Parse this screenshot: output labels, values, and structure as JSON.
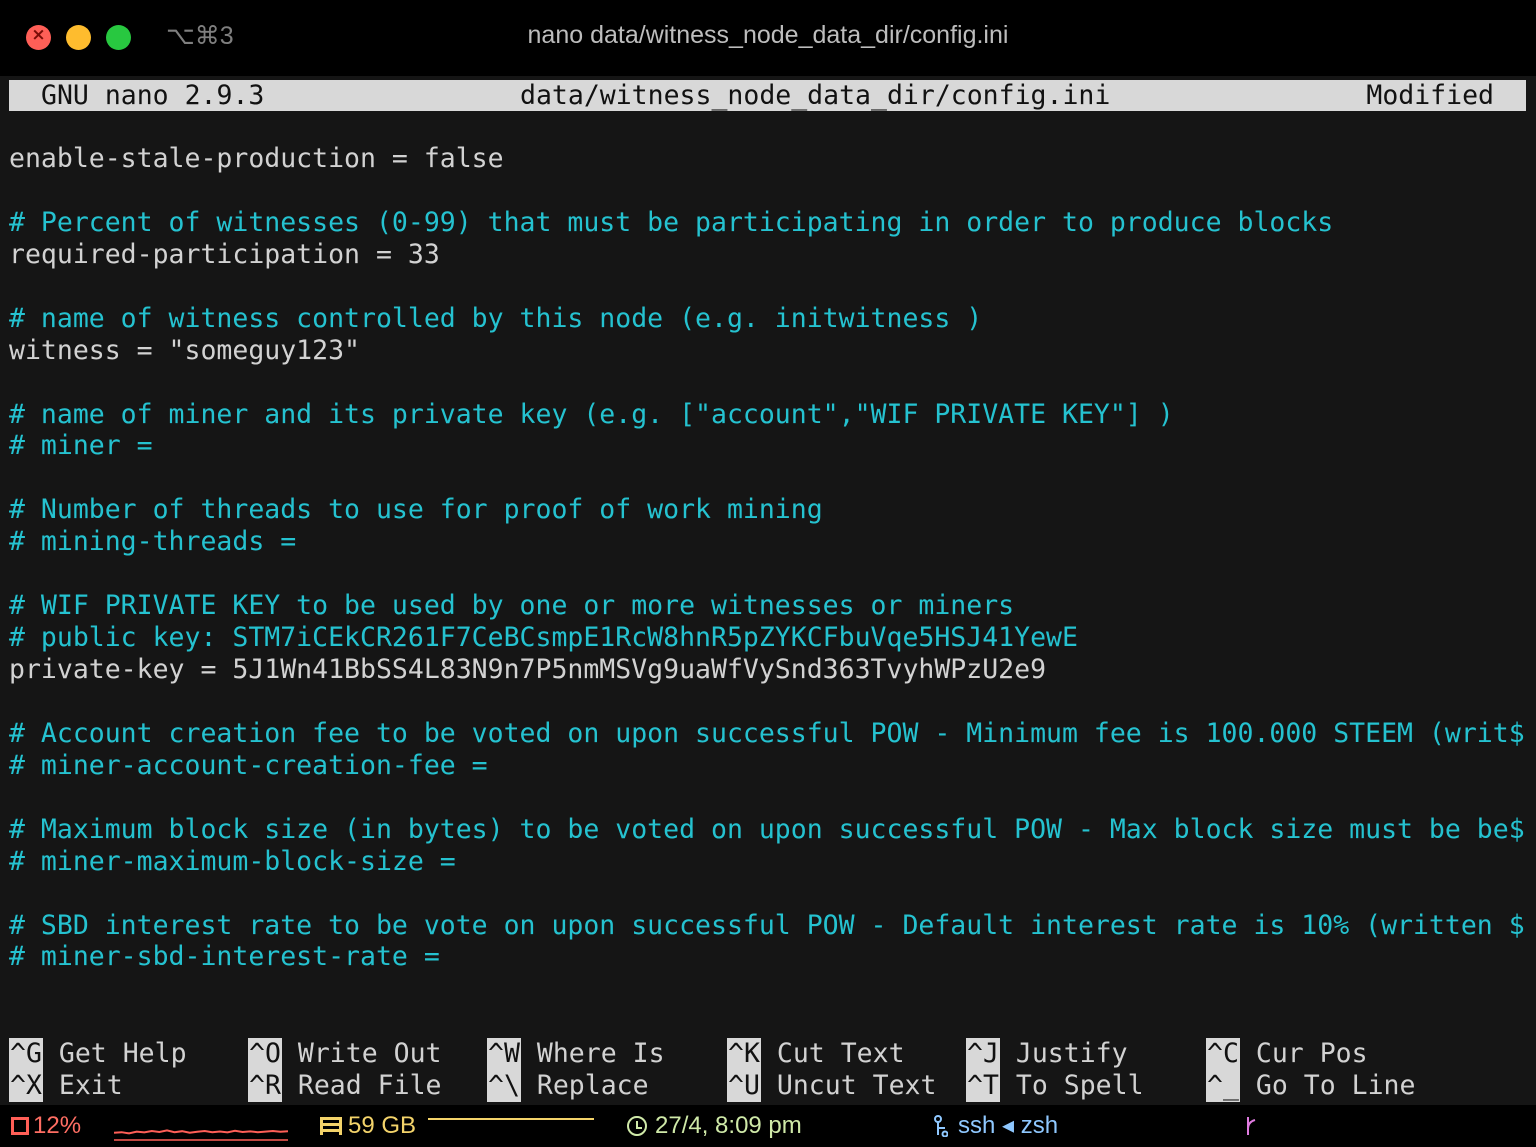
{
  "titlebar": {
    "shortcut": "⌥⌘3",
    "title": "nano data/witness_node_data_dir/config.ini"
  },
  "nano_header": {
    "version": "GNU nano 2.9.3",
    "filename": "data/witness_node_data_dir/config.ini",
    "state": "Modified"
  },
  "buffer": {
    "lines": [
      {
        "kind": "setting",
        "text": "enable-stale-production = false"
      },
      {
        "kind": "blank",
        "text": ""
      },
      {
        "kind": "comment",
        "text": "# Percent of witnesses (0-99) that must be participating in order to produce blocks"
      },
      {
        "kind": "setting",
        "text": "required-participation = 33"
      },
      {
        "kind": "blank",
        "text": ""
      },
      {
        "kind": "comment",
        "text": "# name of witness controlled by this node (e.g. initwitness )"
      },
      {
        "kind": "setting",
        "text": "witness = \"someguy123\""
      },
      {
        "kind": "blank",
        "text": ""
      },
      {
        "kind": "comment",
        "text": "# name of miner and its private key (e.g. [\"account\",\"WIF PRIVATE KEY\"] )"
      },
      {
        "kind": "comment",
        "text": "# miner ="
      },
      {
        "kind": "blank",
        "text": ""
      },
      {
        "kind": "comment",
        "text": "# Number of threads to use for proof of work mining"
      },
      {
        "kind": "comment",
        "text": "# mining-threads ="
      },
      {
        "kind": "blank",
        "text": ""
      },
      {
        "kind": "comment",
        "text": "# WIF PRIVATE KEY to be used by one or more witnesses or miners"
      },
      {
        "kind": "comment",
        "text": "# public key: STM7iCEkCR261F7CeBCsmpE1RcW8hnR5pZYKCFbuVqe5HSJ41YewE"
      },
      {
        "kind": "setting",
        "text": "private-key = 5J1Wn41BbSS4L83N9n7P5nmMSVg9uaWfVySnd363TvyhWPzU2e9"
      },
      {
        "kind": "blank",
        "text": ""
      },
      {
        "kind": "comment",
        "text": "# Account creation fee to be voted on upon successful POW - Minimum fee is 100.000 STEEM (writ$"
      },
      {
        "kind": "comment",
        "text": "# miner-account-creation-fee ="
      },
      {
        "kind": "blank",
        "text": ""
      },
      {
        "kind": "comment",
        "text": "# Maximum block size (in bytes) to be voted on upon successful POW - Max block size must be be$"
      },
      {
        "kind": "comment",
        "text": "# miner-maximum-block-size ="
      },
      {
        "kind": "blank",
        "text": ""
      },
      {
        "kind": "comment",
        "text": "# SBD interest rate to be vote on upon successful POW - Default interest rate is 10% (written $"
      },
      {
        "kind": "comment",
        "text": "# miner-sbd-interest-rate ="
      }
    ]
  },
  "shortcuts": {
    "rows": [
      [
        {
          "key": "^G",
          "label": "Get Help",
          "name": "get-help"
        },
        {
          "key": "^O",
          "label": "Write Out",
          "name": "write-out"
        },
        {
          "key": "^W",
          "label": "Where Is",
          "name": "where-is"
        },
        {
          "key": "^K",
          "label": "Cut Text",
          "name": "cut-text"
        },
        {
          "key": "^J",
          "label": "Justify",
          "name": "justify"
        },
        {
          "key": "^C",
          "label": "Cur Pos",
          "name": "cur-pos"
        }
      ],
      [
        {
          "key": "^X",
          "label": "Exit",
          "name": "exit"
        },
        {
          "key": "^R",
          "label": "Read File",
          "name": "read-file"
        },
        {
          "key": "^\\",
          "label": "Replace",
          "name": "replace"
        },
        {
          "key": "^U",
          "label": "Uncut Text",
          "name": "uncut-text"
        },
        {
          "key": "^T",
          "label": "To Spell",
          "name": "to-spell"
        },
        {
          "key": "^_",
          "label": "Go To Line",
          "name": "go-to-line"
        }
      ]
    ]
  },
  "status_bar": {
    "cpu": "12%",
    "cpu_sparkline": [
      0.35,
      0.4,
      0.3,
      0.45,
      0.38,
      0.5,
      0.42,
      0.55,
      0.4,
      0.48,
      0.36,
      0.44,
      0.5,
      0.4,
      0.46,
      0.38,
      0.52,
      0.42,
      0.47,
      0.4,
      0.45,
      0.5,
      0.43,
      0.48
    ],
    "memory": "59 GB",
    "time": "27/4, 8:09 pm",
    "session": "ssh ◂ zsh"
  },
  "colors": {
    "comment": "#25c2d0",
    "setting": "#d2d2d2",
    "header_bg": "#d8d8d8",
    "cpu": "#ff5f57",
    "memory": "#f3d36a",
    "clock": "#cfe9a8",
    "ssh": "#8fc8ff",
    "branch": "#e07be0"
  }
}
